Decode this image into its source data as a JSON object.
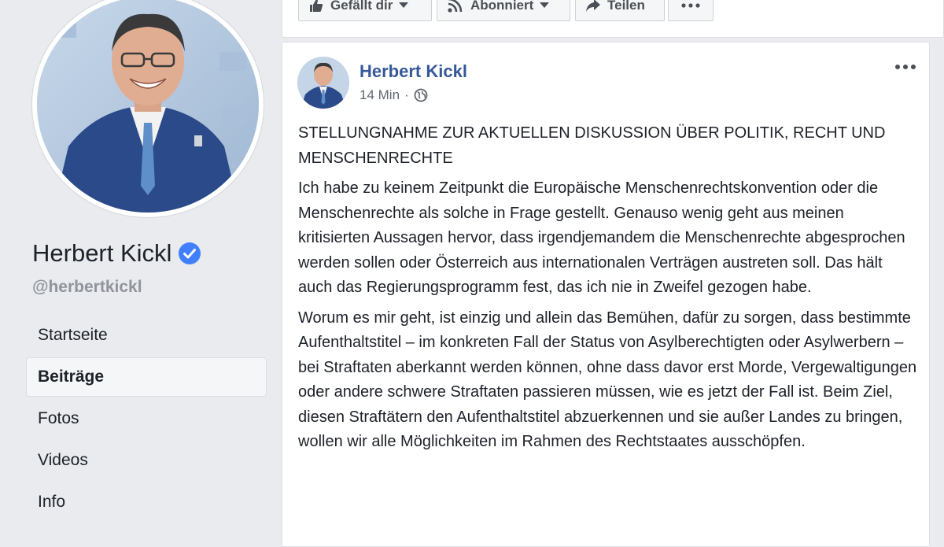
{
  "profile": {
    "name": "Herbert Kickl",
    "handle": "@herbertkickl"
  },
  "nav": {
    "items": [
      "Startseite",
      "Beiträge",
      "Fotos",
      "Videos",
      "Info"
    ],
    "active_index": 1
  },
  "actions": {
    "like_label": "Gefällt dir",
    "follow_label": "Abonniert",
    "share_label": "Teilen"
  },
  "post": {
    "author": "Herbert Kickl",
    "time": "14 Min",
    "paragraphs": [
      "STELLUNGNAHME ZUR AKTUELLEN DISKUSSION ÜBER POLITIK, RECHT UND MENSCHENRECHTE",
      "Ich habe zu keinem Zeitpunkt die Europäische Menschenrechtskonvention oder die Menschenrechte als solche in Frage gestellt. Genauso wenig geht aus meinen kritisierten Aussagen hervor, dass irgendjemandem die Menschenrechte abgesprochen werden sollen oder Österreich aus internationalen Verträgen austreten soll. Das hält auch das Regierungsprogramm fest, das ich nie in Zweifel gezogen habe.",
      "Worum es mir geht, ist einzig und allein das Bemühen, dafür zu sorgen, dass bestimmte Aufenthaltstitel – im konkreten Fall der Status von Asylberechtigten oder Asylwerbern – bei Straftaten aberkannt werden können, ohne dass davor erst Morde, Vergewaltigungen oder andere schwere Straftaten passieren müssen, wie es jetzt der Fall ist. Beim Ziel, diesen Straftätern den Aufenthaltstitel abzuerkennen und sie außer Landes zu bringen, wollen wir alle Möglichkeiten im Rahmen des Rechtstaates ausschöpfen."
    ]
  },
  "colors": {
    "page_bg": "#e9ebee",
    "link_blue": "#365899",
    "verified_blue": "#4080ff",
    "muted": "#90949c"
  },
  "icons": [
    "thumbs-up-icon",
    "rss-icon",
    "share-arrow-icon",
    "more-dots-icon",
    "verified-badge-icon",
    "globe-icon",
    "caret-down-icon"
  ]
}
